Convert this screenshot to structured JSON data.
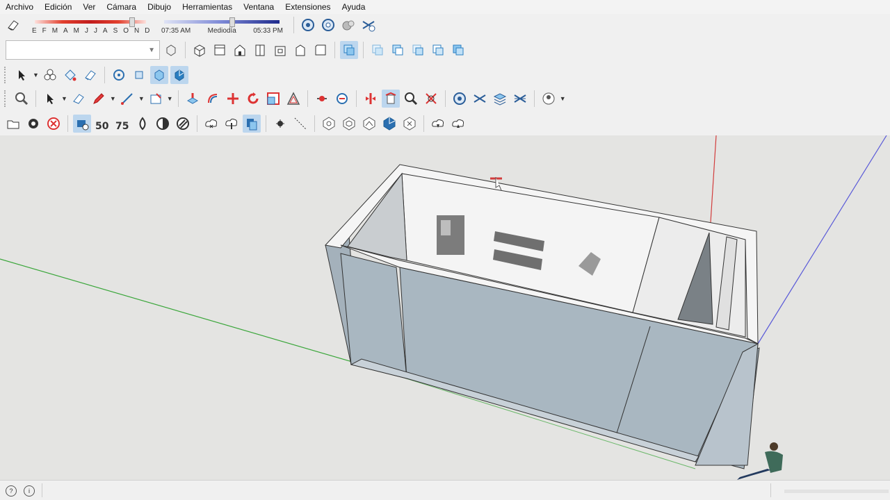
{
  "menu": {
    "items": [
      "Archivo",
      "Edición",
      "Ver",
      "Cámara",
      "Dibujo",
      "Herramientas",
      "Ventana",
      "Extensiones",
      "Ayuda"
    ]
  },
  "shadows": {
    "months": [
      "E",
      "F",
      "M",
      "A",
      "M",
      "J",
      "J",
      "A",
      "S",
      "O",
      "N",
      "D"
    ],
    "time_start": "07:35 AM",
    "time_mid": "Mediodía",
    "time_end": "05:33 PM"
  },
  "layer_combo": {
    "value": ""
  },
  "colors": {
    "axis_red": "#d23c3c",
    "axis_green": "#3aa63a",
    "axis_blue": "#5a5ad8",
    "wall_shade": "#a9b7c1",
    "highlight": "#bcd6ee"
  },
  "icons": {
    "row1": [
      "eraser-icon",
      "shadow-settings-icon",
      "fog-icon",
      "soften-icon",
      "match-photo-icon"
    ],
    "row2": [
      "component-icon",
      "iso-view-icon",
      "top-view-icon",
      "front-view-icon",
      "right-view-icon",
      "back-view-icon",
      "left-view-icon",
      "bottom-view-icon",
      "section-plane-icon",
      "section-display-icon",
      "section-cut-icon",
      "section-fill-icon",
      "section-plane-2-icon",
      "section-plane-3-icon"
    ],
    "row3": [
      "select-icon",
      "paint-bucket-icon",
      "components-icon",
      "eraser-icon",
      "orbit-icon",
      "pan-icon",
      "zoom-window-icon",
      "zoom-extents-icon"
    ],
    "row4": [
      "zoom-icon",
      "select-icon",
      "eraser-icon",
      "pencil-icon",
      "line-icon",
      "rectangle-icon",
      "push-pull-icon",
      "follow-me-icon",
      "move-icon",
      "rotate-icon",
      "scale-icon",
      "offset-icon",
      "tape-icon",
      "protractor-icon",
      "section-icon",
      "walk-icon",
      "look-around-icon",
      "zoom-extents-icon",
      "orbit-icon",
      "pan-icon",
      "layers-icon",
      "styles-icon",
      "user-icon"
    ],
    "row5": [
      "folder-icon",
      "gear-icon",
      "cancel-icon",
      "sandbox-icon",
      "50-icon",
      "75-icon",
      "drop-icon",
      "contrast-icon",
      "hatch-icon",
      "cloud-x-icon",
      "cloud-download-icon",
      "stack-icon",
      "dot-icon",
      "dash-icon",
      "hex-1-icon",
      "hex-2-icon",
      "hex-3-icon",
      "hex-4-icon",
      "hex-5-icon",
      "cloud-1-icon",
      "cloud-2-icon"
    ]
  }
}
